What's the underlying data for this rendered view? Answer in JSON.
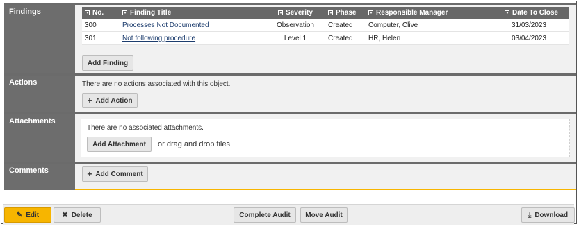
{
  "findings": {
    "header": "Findings",
    "columns": [
      "No.",
      "Finding Title",
      "Severity",
      "Phase",
      "Responsible Manager",
      "Date To Close"
    ],
    "rows": [
      {
        "no": "300",
        "title": "Processes Not Documented",
        "severity": "Observation",
        "phase": "Created",
        "manager": "Computer, Clive",
        "date": "31/03/2023"
      },
      {
        "no": "301",
        "title": "Not following procedure",
        "severity": "Level 1",
        "phase": "Created",
        "manager": "HR, Helen",
        "date": "03/04/2023"
      }
    ],
    "add_label": "Add Finding"
  },
  "actions": {
    "header": "Actions",
    "message": "There are no actions associated with this object.",
    "add_label": "Add Action"
  },
  "attachments": {
    "header": "Attachments",
    "message": "There are no associated attachments.",
    "add_label": "Add Attachment",
    "drag_text": "or drag and drop files"
  },
  "comments": {
    "header": "Comments",
    "add_label": "Add Comment"
  },
  "footer": {
    "edit": "Edit",
    "delete": "Delete",
    "complete": "Complete Audit",
    "move": "Move Audit",
    "download": "Download"
  },
  "colors": {
    "accent": "#f7b500",
    "header_bg": "#6d6d6d"
  }
}
